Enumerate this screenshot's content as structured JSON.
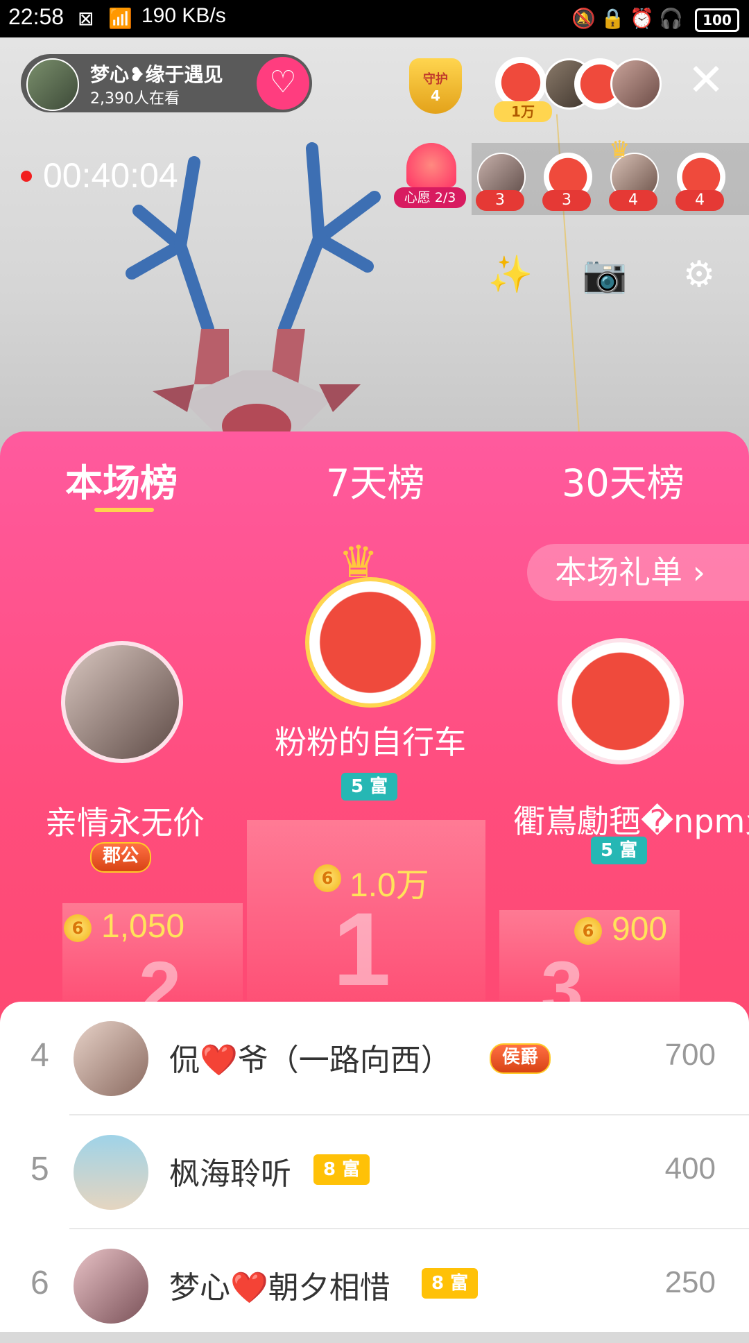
{
  "status_bar": {
    "time": "22:58",
    "net_speed": "190 KB/s",
    "battery": "100"
  },
  "host": {
    "name": "梦心❥缘于遇见",
    "viewers": "2,390人在看"
  },
  "guard": {
    "label": "守护",
    "count": "4"
  },
  "top_contributor": {
    "amount": "1万"
  },
  "timer": "00:40:04",
  "wish": {
    "label": "心愿 2/3"
  },
  "seats": [
    {
      "count": "3"
    },
    {
      "count": "3"
    },
    {
      "count": "4"
    },
    {
      "count": "4"
    }
  ],
  "ranking": {
    "tabs": [
      "本场榜",
      "7天榜",
      "30天榜"
    ],
    "gift_list_label": "本场礼单 ›",
    "podium": [
      {
        "place": "1",
        "name": "粉粉的自行车",
        "badge": "5 富",
        "score": "1.0万"
      },
      {
        "place": "2",
        "name": "亲情永无价",
        "badge": "郡公",
        "score": "1,050"
      },
      {
        "place": "3",
        "name": "衢嶌勴毢�npm爻",
        "badge": "5 富",
        "score": "900"
      }
    ],
    "coin_glyph": "6"
  },
  "list": [
    {
      "rank": "4",
      "name": "侃❤️爷（一路向西）",
      "badge": "侯爵",
      "value": "700"
    },
    {
      "rank": "5",
      "name": "枫海聆听",
      "badge": "8 富",
      "value": "400"
    },
    {
      "rank": "6",
      "name": "梦心❤️朝夕相惜",
      "badge": "8 富",
      "value": "250"
    }
  ]
}
